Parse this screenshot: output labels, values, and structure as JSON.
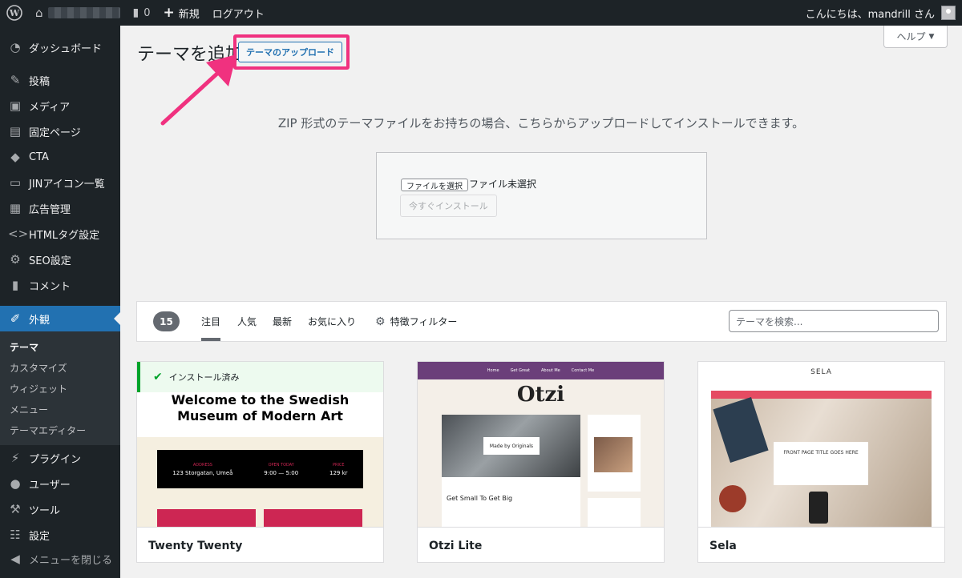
{
  "adminbar": {
    "comment_count": "0",
    "new_label": "新規",
    "logout_label": "ログアウト",
    "greeting": "こんにちは、mandrill さん"
  },
  "sidebar": {
    "items": [
      {
        "label": "ダッシュボード",
        "icon": "dashboard-icon"
      },
      {
        "label": "投稿",
        "icon": "posts-icon"
      },
      {
        "label": "メディア",
        "icon": "media-icon"
      },
      {
        "label": "固定ページ",
        "icon": "pages-icon"
      },
      {
        "label": "CTA",
        "icon": "tag-icon"
      },
      {
        "label": "JINアイコン一覧",
        "icon": "list-icon"
      },
      {
        "label": "広告管理",
        "icon": "ads-icon"
      },
      {
        "label": "HTMLタグ設定",
        "icon": "code-icon"
      },
      {
        "label": "SEO設定",
        "icon": "gear-icon"
      },
      {
        "label": "コメント",
        "icon": "comment-icon"
      },
      {
        "label": "外観",
        "icon": "appearance-icon"
      },
      {
        "label": "プラグイン",
        "icon": "plugin-icon"
      },
      {
        "label": "ユーザー",
        "icon": "user-icon"
      },
      {
        "label": "ツール",
        "icon": "wrench-icon"
      },
      {
        "label": "設定",
        "icon": "settings-icon"
      },
      {
        "label": "メニューを閉じる",
        "icon": "collapse-icon"
      }
    ],
    "submenu": [
      "テーマ",
      "カスタマイズ",
      "ウィジェット",
      "メニュー",
      "テーマエディター"
    ]
  },
  "main": {
    "title": "テーマを追加",
    "upload_button": "テーマのアップロード",
    "help_label": "ヘルプ",
    "upload_description": "ZIP 形式のテーマファイルをお持ちの場合、こちらからアップロードしてインストールできます。",
    "file_button": "ファイルを選択",
    "file_status": "ファイル未選択",
    "install_button": "今すぐインストール"
  },
  "filter": {
    "count": "15",
    "tabs": [
      "注目",
      "人気",
      "最新",
      "お気に入り",
      "特徴フィルター"
    ],
    "search_placeholder": "テーマを検索..."
  },
  "themes": [
    {
      "name": "Twenty Twenty",
      "installed_label": "インストール済み",
      "hero": "Welcome to the Swedish Museum of Modern Art",
      "info": [
        {
          "head": "ADDRESS",
          "value": "123 Storgatan, Umeå"
        },
        {
          "head": "OPEN TODAY",
          "value": "9:00 — 5:00"
        },
        {
          "head": "PRICE",
          "value": "129 kr"
        }
      ]
    },
    {
      "name": "Otzi Lite",
      "logo": "Otzi",
      "nav": [
        "Home",
        "Get Great",
        "About Me",
        "Contact Me"
      ],
      "made_label": "Made by Originals",
      "post_title": "Get Small To Get Big"
    },
    {
      "name": "Sela",
      "site_title": "SELA",
      "hero_text": "FRONT PAGE TITLE GOES HERE"
    }
  ]
}
